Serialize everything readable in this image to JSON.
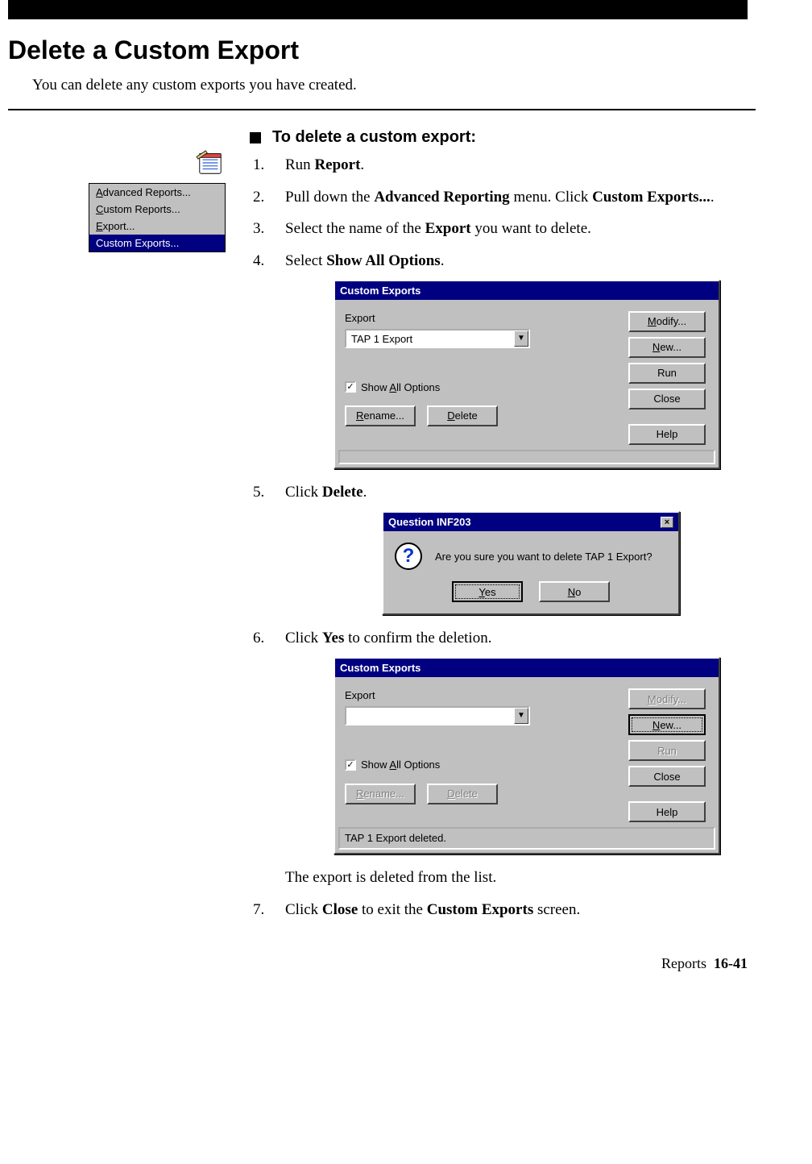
{
  "title": "Delete a Custom Export",
  "intro": "You can delete any custom exports you have created.",
  "proc_heading": "To delete a custom export:",
  "menu": {
    "items": [
      "Advanced Reports...",
      "Custom Reports...",
      "Export...",
      "Custom Exports..."
    ],
    "underlines": [
      "A",
      "C",
      "E",
      ""
    ],
    "selected_index": 3
  },
  "steps": {
    "s1_a": "Run ",
    "s1_b": "Report",
    "s1_c": ".",
    "s2_a": "Pull down the ",
    "s2_b": "Advanced Reporting",
    "s2_c": " menu. Click ",
    "s2_d": "Custom Exports...",
    "s2_e": ".",
    "s3_a": "Select the name of the ",
    "s3_b": "Export",
    "s3_c": " you want to delete.",
    "s4_a": "Select ",
    "s4_b": "Show All Options",
    "s4_c": ".",
    "s5_a": "Click ",
    "s5_b": "Delete",
    "s5_c": ".",
    "s6_a": "Click ",
    "s6_b": "Yes",
    "s6_c": " to confirm the deletion.",
    "s7_a": "Click ",
    "s7_b": "Close",
    "s7_c": " to exit the ",
    "s7_d": "Custom Exports",
    "s7_e": " screen."
  },
  "after_dialog2": "The export is deleted from the list.",
  "dialog1": {
    "title": "Custom Exports",
    "export_label": "Export",
    "export_value": "TAP 1 Export",
    "show_all_checked": true,
    "show_all_label": "Show All Options",
    "show_all_ul": "A",
    "btn_rename": "Rename...",
    "btn_rename_ul": "R",
    "btn_delete": "Delete",
    "btn_delete_ul": "D",
    "btn_modify": "Modify...",
    "btn_modify_ul": "M",
    "btn_new": "New...",
    "btn_new_ul": "N",
    "btn_run": "Run",
    "btn_close": "Close",
    "btn_help": "Help",
    "status": ""
  },
  "question": {
    "title": "Question INF203",
    "msg": "Are you sure you want to delete TAP 1 Export?",
    "yes": "Yes",
    "yes_ul": "Y",
    "no": "No",
    "no_ul": "N"
  },
  "dialog2": {
    "title": "Custom Exports",
    "export_label": "Export",
    "export_value": "",
    "show_all_checked": true,
    "show_all_label": "Show All Options",
    "show_all_ul": "A",
    "btn_rename": "Rename...",
    "btn_rename_ul": "R",
    "btn_delete": "Delete",
    "btn_delete_ul": "D",
    "btn_modify": "Modify...",
    "btn_modify_ul": "M",
    "btn_new": "New...",
    "btn_new_ul": "N",
    "btn_run": "Run",
    "btn_close": "Close",
    "btn_help": "Help",
    "status": "TAP 1 Export deleted."
  },
  "footer": {
    "label": "Reports",
    "page": "16-41"
  }
}
